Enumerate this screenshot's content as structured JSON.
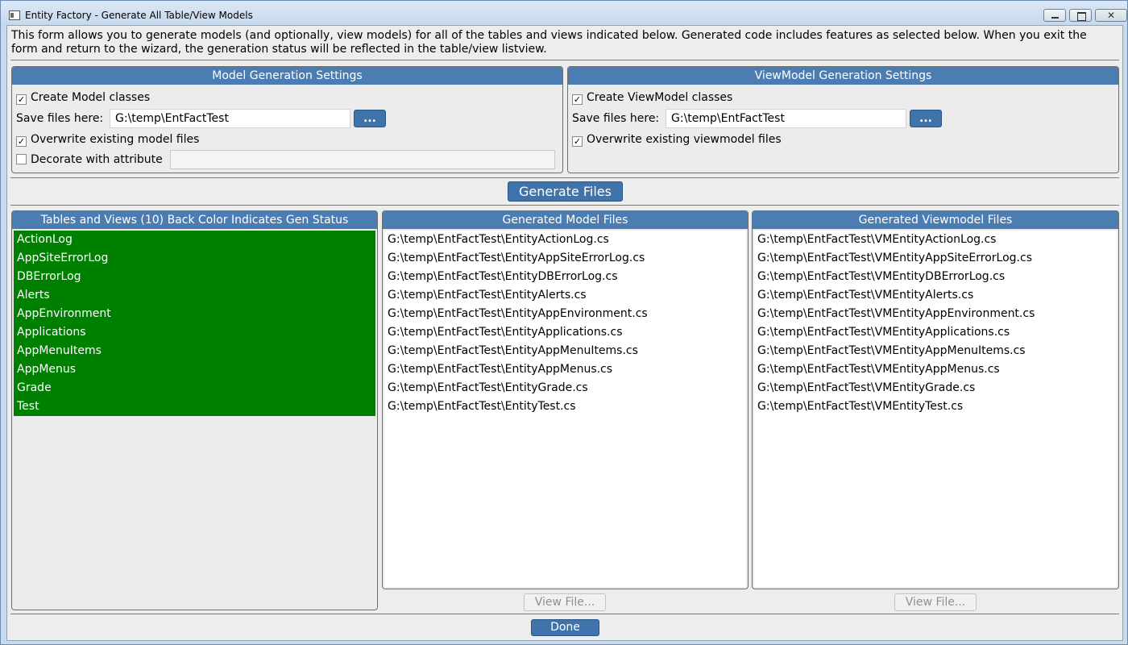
{
  "window": {
    "title": "Entity Factory - Generate All Table/View Models",
    "close_glyph": "✕"
  },
  "description": "This form allows you to generate models (and optionally, view models) for all of the tables and views indicated below. Generated code includes features as selected below. When you exit the form and return to the wizard, the generation status will be reflected in the table/view listview.",
  "model_settings": {
    "header": "Model Generation Settings",
    "create_label": "Create Model classes",
    "create_checked": true,
    "save_label": "Save files here:",
    "save_path": "G:\\temp\\EntFactTest",
    "browse_label": "...",
    "overwrite_label": "Overwrite existing model files",
    "overwrite_checked": true,
    "decorate_label": "Decorate with attribute",
    "decorate_checked": false,
    "decorate_value": ""
  },
  "viewmodel_settings": {
    "header": "ViewModel Generation Settings",
    "create_label": "Create ViewModel classes",
    "create_checked": true,
    "save_label": "Save files here:",
    "save_path": "G:\\temp\\EntFactTest",
    "browse_label": "...",
    "overwrite_label": "Overwrite existing viewmodel files",
    "overwrite_checked": true
  },
  "generate_button": "Generate Files",
  "tables_panel": {
    "header": "Tables and Views (10) Back Color Indicates Gen Status",
    "status_color": "#008000",
    "items": [
      "ActionLog",
      "AppSiteErrorLog",
      "DBErrorLog",
      "Alerts",
      "AppEnvironment",
      "Applications",
      "AppMenuItems",
      "AppMenus",
      "Grade",
      "Test"
    ]
  },
  "model_files_panel": {
    "header": "Generated Model Files",
    "items": [
      "G:\\temp\\EntFactTest\\EntityActionLog.cs",
      "G:\\temp\\EntFactTest\\EntityAppSiteErrorLog.cs",
      "G:\\temp\\EntFactTest\\EntityDBErrorLog.cs",
      "G:\\temp\\EntFactTest\\EntityAlerts.cs",
      "G:\\temp\\EntFactTest\\EntityAppEnvironment.cs",
      "G:\\temp\\EntFactTest\\EntityApplications.cs",
      "G:\\temp\\EntFactTest\\EntityAppMenuItems.cs",
      "G:\\temp\\EntFactTest\\EntityAppMenus.cs",
      "G:\\temp\\EntFactTest\\EntityGrade.cs",
      "G:\\temp\\EntFactTest\\EntityTest.cs"
    ],
    "view_button": "View File..."
  },
  "viewmodel_files_panel": {
    "header": "Generated Viewmodel Files",
    "items": [
      "G:\\temp\\EntFactTest\\VMEntityActionLog.cs",
      "G:\\temp\\EntFactTest\\VMEntityAppSiteErrorLog.cs",
      "G:\\temp\\EntFactTest\\VMEntityDBErrorLog.cs",
      "G:\\temp\\EntFactTest\\VMEntityAlerts.cs",
      "G:\\temp\\EntFactTest\\VMEntityAppEnvironment.cs",
      "G:\\temp\\EntFactTest\\VMEntityApplications.cs",
      "G:\\temp\\EntFactTest\\VMEntityAppMenuItems.cs",
      "G:\\temp\\EntFactTest\\VMEntityAppMenus.cs",
      "G:\\temp\\EntFactTest\\VMEntityGrade.cs",
      "G:\\temp\\EntFactTest\\VMEntityTest.cs"
    ],
    "view_button": "View File..."
  },
  "done_button": "Done"
}
